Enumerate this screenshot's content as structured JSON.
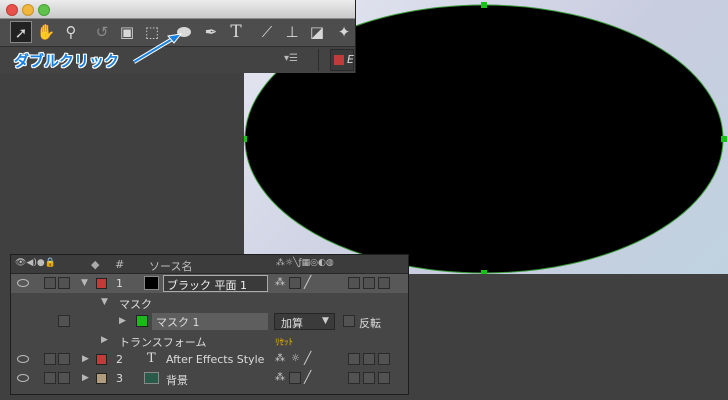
{
  "callout": {
    "label": "ダブルクリック"
  },
  "comp": {
    "shape_color": "#000000",
    "path_color": "#3a9a3a",
    "handle_color": "#19c219"
  },
  "panel_header": {
    "right_tab_label": "E"
  },
  "tools": [
    "selection-tool",
    "hand-tool",
    "zoom-tool",
    "rotate-tool",
    "camera-tool",
    "pan-behind-tool",
    "ellipse-mask-tool",
    "pen-tool",
    "type-tool",
    "brush-tool",
    "clone-stamp-tool",
    "eraser-tool",
    "puppet-tool"
  ],
  "timeline": {
    "header": {
      "number": "#",
      "source_name": "ソース名"
    },
    "layers": [
      {
        "num": "1",
        "name": "ブラック 平面 1",
        "label_color": "#c23b3b"
      },
      {
        "num": "2",
        "name": "After Effects Style",
        "label_color": "#c23b3b"
      },
      {
        "num": "3",
        "name": "背景",
        "label_color": "#b09d7e"
      }
    ],
    "mask_group": "マスク",
    "mask": {
      "name": "マスク 1",
      "color": "#1cb81c",
      "mode": "加算",
      "invert_label": "反転"
    },
    "transform": {
      "label": "トランスフォーム",
      "reset_label": "ﾘｾｯﾄ"
    }
  }
}
